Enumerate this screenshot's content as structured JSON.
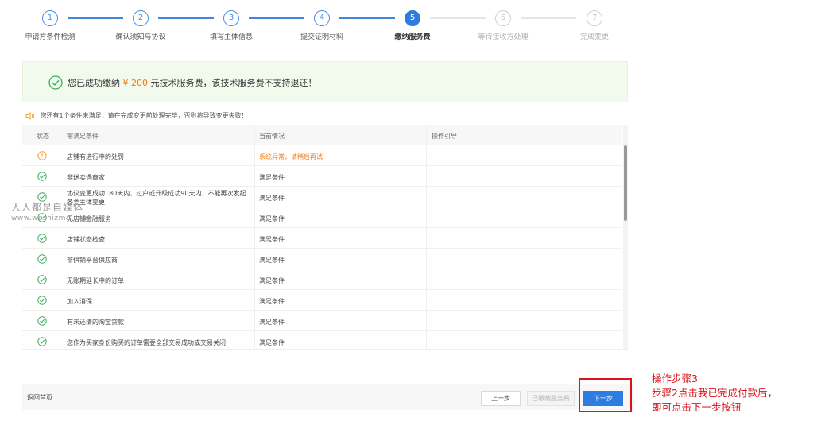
{
  "stepper": {
    "steps": [
      {
        "num": "1",
        "label": "申请方条件检测",
        "state": "done"
      },
      {
        "num": "2",
        "label": "确认须知与协议",
        "state": "done"
      },
      {
        "num": "3",
        "label": "填写主体信息",
        "state": "done"
      },
      {
        "num": "4",
        "label": "提交证明材料",
        "state": "done"
      },
      {
        "num": "5",
        "label": "缴纳服务费",
        "state": "active"
      },
      {
        "num": "6",
        "label": "等待接收方处理",
        "state": "pending"
      },
      {
        "num": "7",
        "label": "完成变更",
        "state": "pending"
      }
    ]
  },
  "success": {
    "prefix": "您已成功缴纳",
    "amount": "¥ 200",
    "suffix": "元技术服务费，该技术服务费不支持退还！",
    "color": "#f07a15"
  },
  "warning": {
    "text": "您还有1个条件未满足，请在完成变更前处理完毕，否则将导致变更失败！",
    "icon": "speaker-icon"
  },
  "table": {
    "headers": {
      "status": "状态",
      "condition": "需满足条件",
      "current": "当前情况",
      "guide": "操作引导"
    },
    "rows": [
      {
        "status": "warning",
        "condition": "店铺有进行中的处罚",
        "current": "系统异常，请稍后再试",
        "error": true
      },
      {
        "status": "ok",
        "condition": "非迷卖遇商家",
        "current": "满足条件"
      },
      {
        "status": "ok",
        "condition": "协议变更成功180天内、过户或升级成功90天内，不能再次发起各类主体变更",
        "current": "满足条件",
        "twoLine": true
      },
      {
        "status": "ok",
        "condition": "无店铺金融服务",
        "current": "满足条件"
      },
      {
        "status": "ok",
        "condition": "店铺状态检查",
        "current": "满足条件"
      },
      {
        "status": "ok",
        "condition": "非供销平台供应商",
        "current": "满足条件"
      },
      {
        "status": "ok",
        "condition": "无账期延长中的订单",
        "current": "满足条件"
      },
      {
        "status": "ok",
        "condition": "加入消保",
        "current": "满足条件"
      },
      {
        "status": "ok",
        "condition": "有未还清的淘宝贷款",
        "current": "满足条件"
      },
      {
        "status": "ok",
        "condition": "您作为买家身份购买的订单需要全部交易成功或交易关闭",
        "current": "满足条件"
      }
    ]
  },
  "watermark": {
    "cn": "人人都是自媒体",
    "en": "www.woshizme.com"
  },
  "footer": {
    "home": "返回首页",
    "prev": "上一步",
    "paid": "已缴纳服务费",
    "next": "下一步"
  },
  "annotation": {
    "line1": "操作步骤3",
    "line2": "步骤2点击我已完成付款后，",
    "line3": "即可点击下一步按钮"
  },
  "colors": {
    "primary": "#2f7ce0",
    "success": "#3fae5f",
    "warning": "#f5a623",
    "annotation": "#d9141b"
  }
}
